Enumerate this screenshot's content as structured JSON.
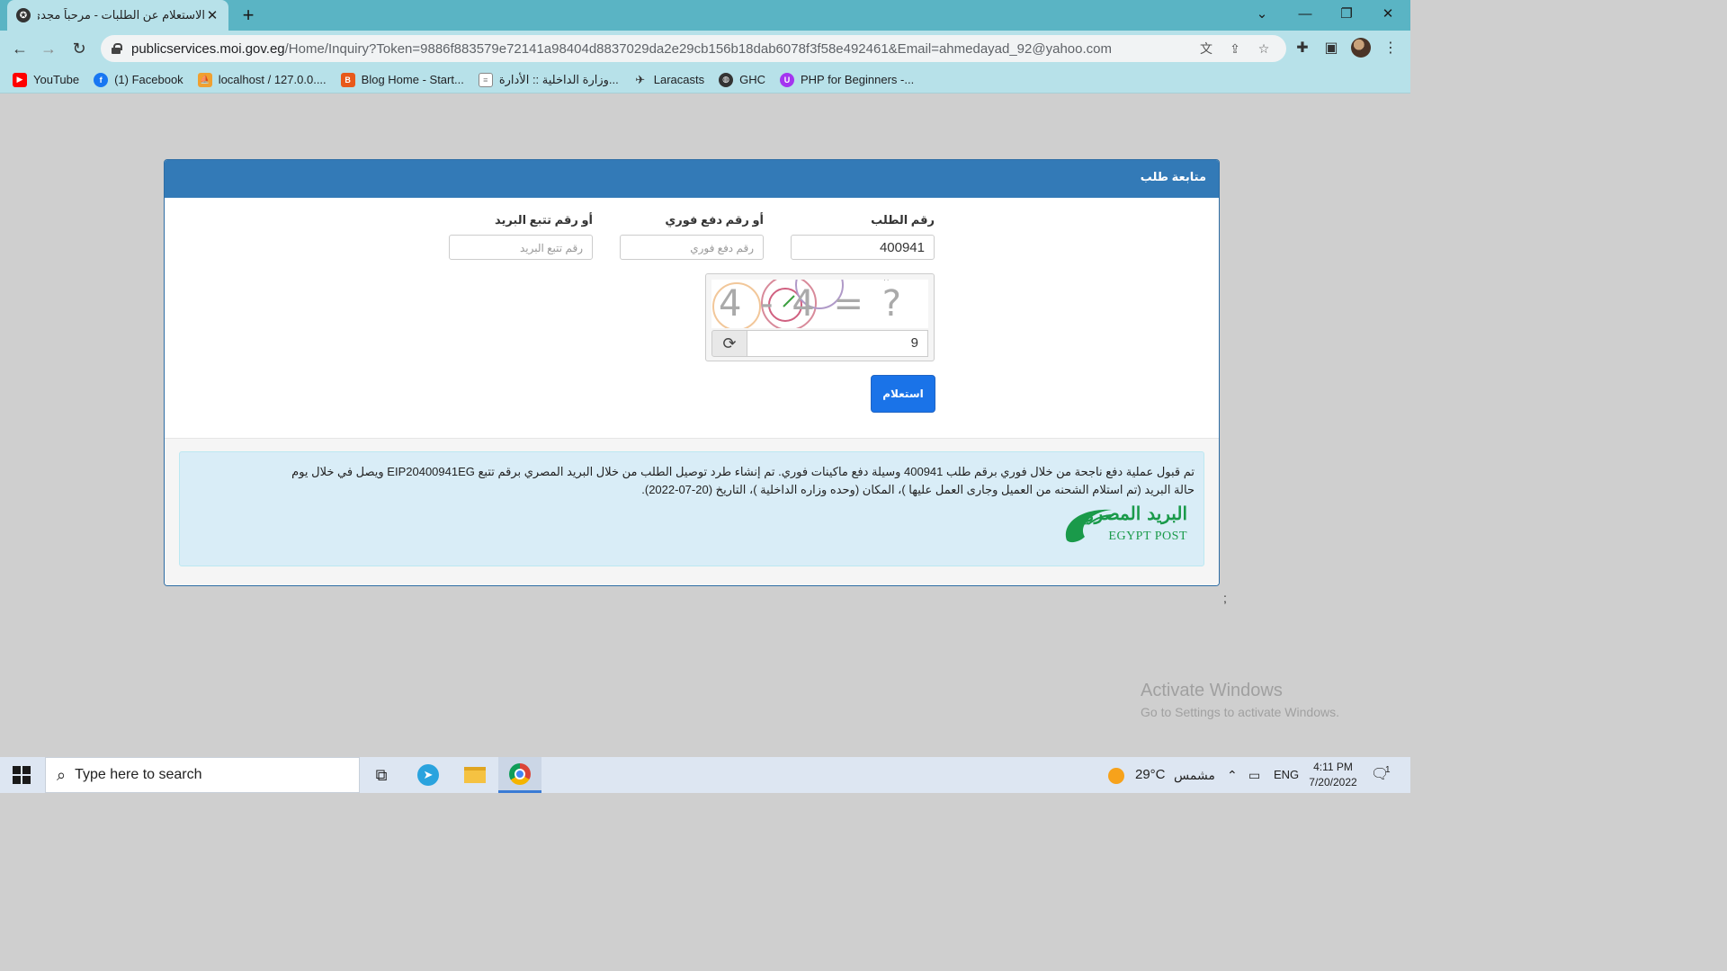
{
  "browser": {
    "tab_title": "الاستعلام عن الطلبات - مرحباً مجدى",
    "tab_favicon": "moi-logo-icon",
    "url_host": "publicservices.moi.gov.eg",
    "url_path": "/Home/Inquiry?Token=9886f883579e72141a98404d8837029da2e29cb156b18dab6078f3f58e492461&Email=ahmedayad_92@yahoo.com"
  },
  "bookmarks": [
    {
      "label": "YouTube",
      "icon": "youtube-icon",
      "color": "#ff0000"
    },
    {
      "label": "(1) Facebook",
      "icon": "facebook-icon",
      "color": "#1877f2"
    },
    {
      "label": "localhost / 127.0.0....",
      "icon": "phpmyadmin-icon",
      "color": "#f0a030"
    },
    {
      "label": "Blog Home - Start...",
      "icon": "startbootstrap-icon",
      "color": "#e8591a"
    },
    {
      "label": "وزارة الداخلية :: الأدارة...",
      "icon": "page-icon",
      "color": "#888888"
    },
    {
      "label": "Laracasts",
      "icon": "laracasts-icon",
      "color": "#444444"
    },
    {
      "label": "GHC",
      "icon": "globe-icon",
      "color": "#333333"
    },
    {
      "label": "PHP for Beginners -...",
      "icon": "udemy-icon",
      "color": "#a435f0"
    }
  ],
  "page": {
    "panel_title": "متابعة طلب",
    "request_label": "رقم الطلب",
    "request_value": "400941",
    "fawry_label": "أو رقم دفع فوري",
    "fawry_placeholder": "رقم دفع فوري",
    "post_label": "أو رقم تتبع البريد",
    "post_placeholder": "رقم تتبع البريد",
    "captcha_text": "4 - 4 = ?",
    "captcha_value": "9",
    "submit_label": "استعلام",
    "alert_line1": "تم قبول عملية دفع ناجحة من خلال فوري برقم طلب 400941 وسيلة دفع ماكينات فوري. تم إنشاء طرد توصيل الطلب من خلال البريد المصري برقم تتبع EIP20400941EG ويصل في خلال يوم",
    "alert_line2": "حالة البريد (تم استلام الشحنه من العميل وجارى العمل عليها )، المكان (وحده وزاره الداخلية )، التاريخ (20-07-2022).",
    "egypt_post_ar": "البريد المصري",
    "egypt_post_en": "EGYPT POST",
    "stray_char": ";"
  },
  "watermark": {
    "line1": "Activate Windows",
    "line2": "Go to Settings to activate Windows."
  },
  "taskbar": {
    "search_placeholder": "Type here to search",
    "weather": "29°C",
    "weather_desc": "مشمس",
    "language": "ENG",
    "time": "4:11 PM",
    "date": "7/20/2022",
    "notif_count": "1"
  }
}
